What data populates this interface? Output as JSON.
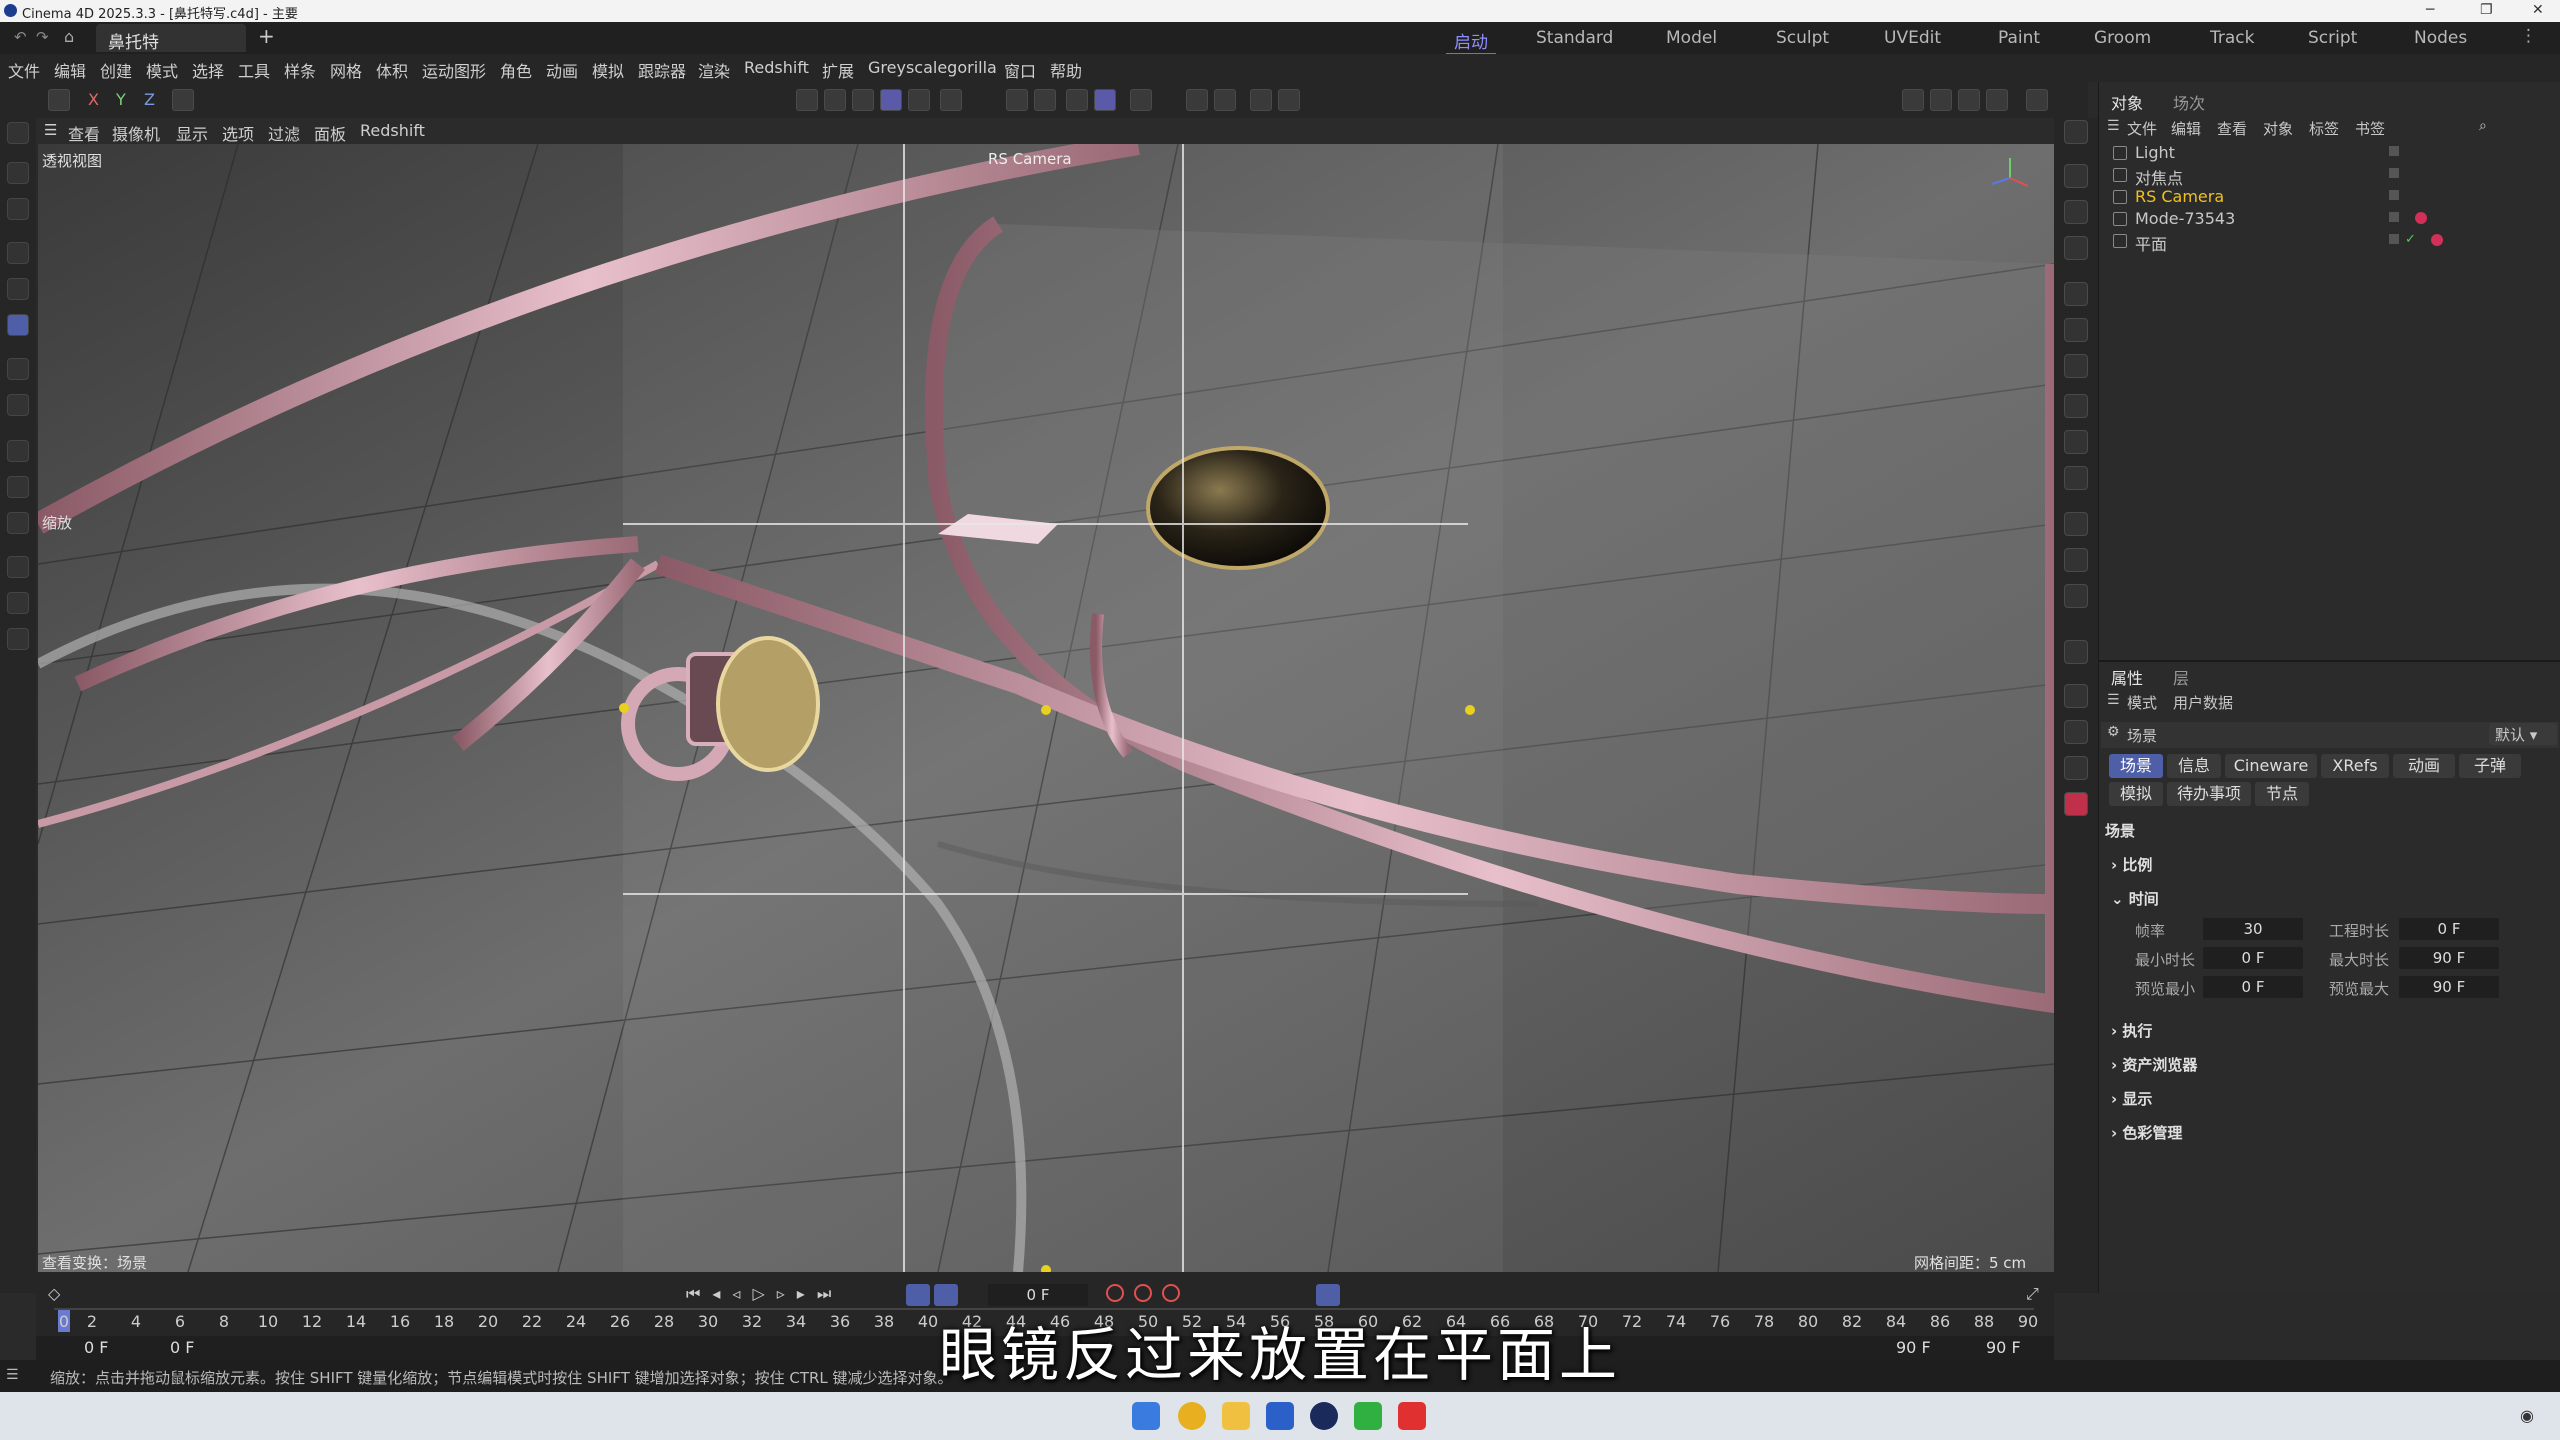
{
  "window": {
    "title": "Cinema 4D 2025.3.3 - [鼻托特写.c4d] - 主要",
    "doc_tab": "鼻托特写.c4d"
  },
  "layouts": [
    "启动",
    "Standard",
    "Model",
    "Sculpt",
    "UVEdit",
    "Paint",
    "Groom",
    "Track",
    "Script",
    "Nodes"
  ],
  "menus": [
    "文件",
    "编辑",
    "创建",
    "模式",
    "选择",
    "工具",
    "样条",
    "网格",
    "体积",
    "运动图形",
    "角色",
    "动画",
    "模拟",
    "跟踪器",
    "渲染",
    "Redshift",
    "扩展",
    "Greyscalegorilla",
    "窗口",
    "帮助"
  ],
  "axis_buttons": [
    "X",
    "Y",
    "Z"
  ],
  "viewport_menu": [
    "查看",
    "摄像机",
    "显示",
    "选项",
    "过滤",
    "面板",
    "Redshift"
  ],
  "viewport": {
    "name": "透视视图",
    "camera": "RS Camera",
    "zoom_label": "缩放",
    "transform_label": "查看变换：场景",
    "grid_spacing": "网格间距：5 cm"
  },
  "object_panel": {
    "tabs": [
      "对象",
      "场次"
    ],
    "menu": [
      "文件",
      "编辑",
      "查看",
      "对象",
      "标签",
      "书签"
    ],
    "objects": [
      {
        "name": "Light",
        "color": "#c8c8c8"
      },
      {
        "name": "对焦点",
        "color": "#c8c8c8"
      },
      {
        "name": "RS Camera",
        "color": "#f0c020"
      },
      {
        "name": "Mode-73543",
        "color": "#c8c8c8"
      },
      {
        "name": "平面",
        "color": "#c8c8c8"
      }
    ]
  },
  "attr_panel": {
    "tabs": [
      "属性",
      "层"
    ],
    "menu": [
      "模式",
      "用户数据"
    ],
    "context": "场景",
    "preset": "默认",
    "buttons_row1": [
      "场景",
      "信息",
      "Cineware",
      "XRefs",
      "动画",
      "子弹"
    ],
    "buttons_row2": [
      "模拟",
      "待办事项",
      "节点"
    ],
    "section": "场景",
    "groups": [
      "比例",
      "时间"
    ],
    "fields": [
      {
        "label": "帧率",
        "value": "30"
      },
      {
        "label": "工程时长",
        "value": "0 F"
      },
      {
        "label": "最小时长",
        "value": "0 F"
      },
      {
        "label": "最大时长",
        "value": "90 F"
      },
      {
        "label": "预览最小",
        "value": "0 F"
      },
      {
        "label": "预览最大",
        "value": "90 F"
      }
    ],
    "groups_after": [
      "执行",
      "资产浏览器",
      "显示",
      "色彩管理"
    ]
  },
  "timeline": {
    "current_frame": "0 F",
    "ticks": [
      "0",
      "2",
      "4",
      "6",
      "8",
      "10",
      "12",
      "14",
      "16",
      "18",
      "20",
      "22",
      "24",
      "26",
      "28",
      "30",
      "32",
      "34",
      "36",
      "38",
      "40",
      "42",
      "44",
      "46",
      "48",
      "50",
      "52",
      "54",
      "56",
      "58",
      "60",
      "62",
      "64",
      "66",
      "68",
      "70",
      "72",
      "74",
      "76",
      "78",
      "80",
      "82",
      "84",
      "86",
      "88",
      "90"
    ],
    "start_a": "0 F",
    "start_b": "0 F",
    "end_a": "90 F",
    "end_b": "90 F"
  },
  "status": "缩放：点击并拖动鼠标缩放元素。按住 SHIFT 键量化缩放；节点编辑模式时按住 SHIFT 键增加选择对象；按住 CTRL 键减少选择对象。",
  "subtitle": "眼镜反过来放置在平面上"
}
